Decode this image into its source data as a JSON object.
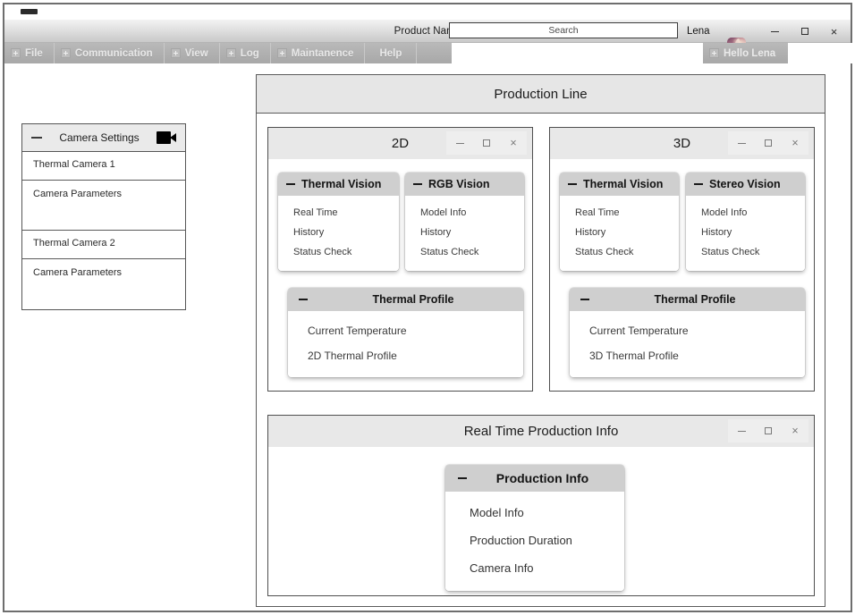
{
  "titlebar": {
    "product_name": "Product Name",
    "search_placeholder": "Search",
    "search_value": "",
    "user_name": "Lena",
    "avatar_name": "avatar",
    "minimize": "–",
    "maximize": "□",
    "close": "×"
  },
  "menu": {
    "items": [
      {
        "label": "File",
        "has_icon": true
      },
      {
        "label": "Communication",
        "has_icon": true
      },
      {
        "label": "View",
        "has_icon": true
      },
      {
        "label": "Log",
        "has_icon": true
      },
      {
        "label": "Maintanence",
        "has_icon": true
      },
      {
        "label": "Help",
        "has_icon": false
      }
    ],
    "hello": "Hello Lena"
  },
  "sidebar": {
    "title": "Camera Settings",
    "icon": "video-camera-icon",
    "collapse": "–",
    "rows": [
      {
        "label": "Thermal Camera 1",
        "size": "short"
      },
      {
        "label": "Camera Parameters",
        "size": "tall"
      },
      {
        "label": "Thermal Camera 2",
        "size": "short"
      },
      {
        "label": "Camera Parameters",
        "size": "tall"
      }
    ]
  },
  "production_line": {
    "title": "Production Line",
    "windows": {
      "twod": {
        "title": "2D",
        "cards": [
          {
            "title": "Thermal Vision",
            "items": [
              "Real Time",
              "History",
              "Status Check"
            ]
          },
          {
            "title": "RGB Vision",
            "items": [
              "Model Info",
              "History",
              "Status Check"
            ]
          }
        ],
        "profile": {
          "title": "Thermal Profile",
          "items": [
            "Current Temperature",
            "2D Thermal Profile"
          ]
        }
      },
      "threed": {
        "title": "3D",
        "cards": [
          {
            "title": "Thermal Vision",
            "items": [
              "Real Time",
              "History",
              "Status Check"
            ]
          },
          {
            "title": "Stereo Vision",
            "items": [
              "Model Info",
              "History",
              "Status Check"
            ]
          }
        ],
        "profile": {
          "title": "Thermal Profile",
          "items": [
            "Current Temperature",
            "3D Thermal Profile"
          ]
        }
      },
      "realtime": {
        "title": "Real Time Production Info",
        "card": {
          "title": "Production Info",
          "items": [
            "Model Info",
            "Production Duration",
            "Camera Info"
          ]
        }
      }
    }
  }
}
